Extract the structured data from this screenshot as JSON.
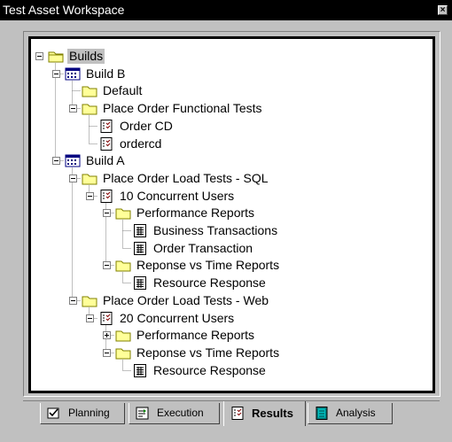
{
  "window": {
    "title": "Test Asset Workspace",
    "close_label": "×"
  },
  "tree": {
    "nodes": [
      {
        "id": "n0",
        "label": "Builds",
        "type": "root-folder",
        "expander": "minus",
        "selected": true
      },
      {
        "id": "n1",
        "label": "Build B",
        "type": "build",
        "expander": "minus"
      },
      {
        "id": "n2",
        "label": "Default",
        "type": "folder",
        "expander": "none"
      },
      {
        "id": "n3",
        "label": "Place Order Functional Tests",
        "type": "folder",
        "expander": "minus"
      },
      {
        "id": "n4",
        "label": "Order CD",
        "type": "test-log",
        "expander": "none"
      },
      {
        "id": "n5",
        "label": "ordercd",
        "type": "test-log",
        "expander": "none"
      },
      {
        "id": "n6",
        "label": "Build A",
        "type": "build",
        "expander": "minus"
      },
      {
        "id": "n7",
        "label": "Place Order Load Tests - SQL",
        "type": "folder",
        "expander": "minus"
      },
      {
        "id": "n8",
        "label": "10 Concurrent Users",
        "type": "test-log",
        "expander": "minus"
      },
      {
        "id": "n9",
        "label": "Performance Reports",
        "type": "folder",
        "expander": "minus"
      },
      {
        "id": "n10",
        "label": "Business Transactions",
        "type": "report",
        "expander": "none"
      },
      {
        "id": "n11",
        "label": "Order Transaction",
        "type": "report",
        "expander": "none"
      },
      {
        "id": "n12",
        "label": "Reponse vs Time Reports",
        "type": "folder",
        "expander": "minus"
      },
      {
        "id": "n13",
        "label": "Resource Response",
        "type": "report",
        "expander": "none"
      },
      {
        "id": "n14",
        "label": "Place Order Load Tests - Web",
        "type": "folder",
        "expander": "minus"
      },
      {
        "id": "n15",
        "label": "20 Concurrent Users",
        "type": "test-log",
        "expander": "minus"
      },
      {
        "id": "n16",
        "label": "Performance Reports",
        "type": "folder",
        "expander": "plus"
      },
      {
        "id": "n17",
        "label": "Reponse vs Time Reports",
        "type": "folder",
        "expander": "minus"
      },
      {
        "id": "n18",
        "label": "Resource Response",
        "type": "report",
        "expander": "none"
      }
    ]
  },
  "tabs": [
    {
      "label": "Planning",
      "icon": "planning-icon",
      "active": false
    },
    {
      "label": "Execution",
      "icon": "execution-icon",
      "active": false
    },
    {
      "label": "Results",
      "icon": "results-icon",
      "active": true
    },
    {
      "label": "Analysis",
      "icon": "analysis-icon",
      "active": false
    }
  ],
  "colors": {
    "folder": "#ffff99",
    "folder_outline": "#808000",
    "build": "#000080",
    "selection": "#c0c0c0"
  }
}
